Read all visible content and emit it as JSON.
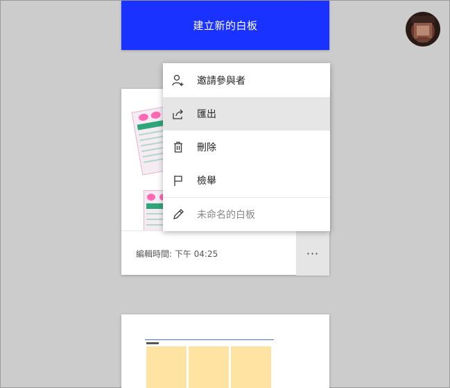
{
  "header": {
    "new_board_label": "建立新的白板"
  },
  "menu": {
    "items": [
      {
        "label": "邀請參與者",
        "icon": "add-person-icon"
      },
      {
        "label": "匯出",
        "icon": "share-export-icon"
      },
      {
        "label": "刪除",
        "icon": "trash-icon"
      },
      {
        "label": "檢舉",
        "icon": "flag-icon"
      }
    ],
    "rename_placeholder": "未命名的白板"
  },
  "card": {
    "edited_label": "編輯時間: 下午 04:25",
    "more_label": "···"
  },
  "colors": {
    "accent": "#1a32ff",
    "background": "#cccccc"
  }
}
